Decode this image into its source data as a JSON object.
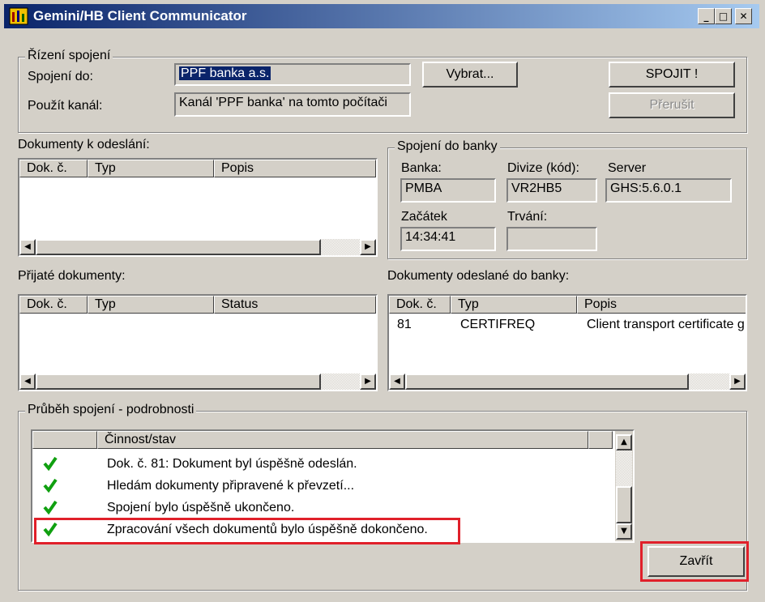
{
  "window": {
    "title": "Gemini/HB Client Communicator",
    "controls": {
      "minimize": "_",
      "maximize": "□",
      "close": "✕"
    }
  },
  "connection_control": {
    "group_title": "Řízení spojení",
    "connect_to_label": "Spojení do:",
    "connect_to_value": "PPF banka a.s.",
    "channel_label": "Použít kanál:",
    "channel_value": "Kanál 'PPF banka' na tomto počítači",
    "select_button": "Vybrat...",
    "connect_button": "SPOJIT !",
    "interrupt_button": "Přerušit"
  },
  "documents_to_send": {
    "label": "Dokumenty k odeslání:",
    "columns": [
      "Dok. č.",
      "Typ",
      "Popis"
    ],
    "rows": []
  },
  "bank_connection": {
    "group_title": "Spojení do banky",
    "bank_label": "Banka:",
    "bank_value": "PMBA",
    "division_label": "Divize (kód):",
    "division_value": "VR2HB5",
    "server_label": "Server",
    "server_value": "GHS:5.6.0.1",
    "start_label": "Začátek",
    "start_value": "14:34:41",
    "duration_label": "Trvání:",
    "duration_value": ""
  },
  "received_documents": {
    "label": "Přijaté dokumenty:",
    "columns": [
      "Dok. č.",
      "Typ",
      "Status"
    ],
    "rows": []
  },
  "sent_documents": {
    "label": "Dokumenty odeslané do banky:",
    "columns": [
      "Dok. č.",
      "Typ",
      "Popis"
    ],
    "rows": [
      {
        "doc": "81",
        "type": "CERTIFREQ",
        "desc": "Client transport certificate g"
      }
    ]
  },
  "progress_details": {
    "group_title": "Průběh spojení - podrobnosti",
    "column": "Činnost/stav",
    "rows": [
      {
        "status": "ok",
        "text": "Dok. č. 81: Dokument byl úspěšně odeslán."
      },
      {
        "status": "ok",
        "text": "Hledám dokumenty připravené k převzetí..."
      },
      {
        "status": "ok",
        "text": "Spojení bylo úspěšně ukončeno."
      },
      {
        "status": "ok",
        "text": "Zpracování všech dokumentů bylo úspěšně dokončeno."
      }
    ]
  },
  "close_button": "Zavřít",
  "colors": {
    "titlebar_start": "#0a246a",
    "titlebar_end": "#a6caf0",
    "face": "#d4d0c8",
    "highlight_red": "#e0202a",
    "check_green": "#10a010",
    "selection": "#0a246a"
  },
  "icons": {
    "app": "app-icon",
    "check": "check-icon",
    "scroll_left": "arrow-left-icon",
    "scroll_right": "arrow-right-icon",
    "scroll_up": "arrow-up-icon",
    "scroll_down": "arrow-down-icon"
  }
}
